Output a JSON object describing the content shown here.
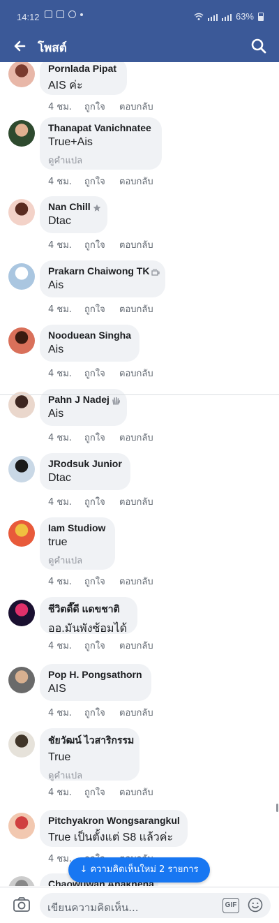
{
  "status_bar": {
    "time": "14:12",
    "battery": "63%"
  },
  "nav": {
    "title": "โพสต์"
  },
  "accent": "#3b5998",
  "comments": [
    {
      "name": "Pornlada Pipat",
      "text": "AIS ค่ะ",
      "translate": "",
      "time": "4 ชม.",
      "like": "ถูกใจ",
      "reply": "ตอบกลับ",
      "avatar_colors": [
        "#e8b7a8",
        "#7a3b2e"
      ]
    },
    {
      "name": "Thanapat Vanichnatee",
      "text": "True+Ais",
      "translate": "ดูคำแปล",
      "time": "4 ชม.",
      "like": "ถูกใจ",
      "reply": "ตอบกลับ",
      "avatar_colors": [
        "#2e4a2e",
        "#e0b090"
      ]
    },
    {
      "name": "Nan Chill",
      "badge": "star-icon",
      "text": "Dtac",
      "translate": "",
      "time": "4 ชม.",
      "like": "ถูกใจ",
      "reply": "ตอบกลับ",
      "avatar_colors": [
        "#f3d2c8",
        "#5a2b20"
      ]
    },
    {
      "name": "Prakarn Chaiwong TK",
      "badge": "coffee-icon",
      "text": "Ais",
      "translate": "",
      "time": "4 ชม.",
      "like": "ถูกใจ",
      "reply": "ตอบกลับ",
      "avatar_colors": [
        "#aac6e0",
        "#ffffff"
      ]
    },
    {
      "name": "Nooduean Singha",
      "text": "Ais",
      "translate": "",
      "time": "4 ชม.",
      "like": "ถูกใจ",
      "reply": "ตอบกลับ",
      "avatar_colors": [
        "#d9705a",
        "#3a1a10"
      ]
    },
    {
      "name": "Pahn J Nadej",
      "badge": "wave-icon",
      "text": "Ais",
      "translate": "",
      "time": "4 ชม.",
      "like": "ถูกใจ",
      "reply": "ตอบกลับ",
      "avatar_colors": [
        "#ead7cc",
        "#3d2620"
      ]
    },
    {
      "name": "JRodsuk Junior",
      "text": "Dtac",
      "translate": "",
      "time": "4 ชม.",
      "like": "ถูกใจ",
      "reply": "ตอบกลับ",
      "avatar_colors": [
        "#c9d8e6",
        "#1a1a1a"
      ]
    },
    {
      "name": "Iam Studiow",
      "text": "true",
      "translate": "ดูคำแปล",
      "time": "4 ชม.",
      "like": "ถูกใจ",
      "reply": "ตอบกลับ",
      "avatar_colors": [
        "#e85a3a",
        "#f0c040"
      ]
    },
    {
      "name": "ชีวิตดี๊ดี แดขชาติ",
      "text": "ออ.มันพังซ้อมได้",
      "translate": "",
      "time": "4 ชม.",
      "like": "ถูกใจ",
      "reply": "ตอบกลับ",
      "avatar_colors": [
        "#1a1030",
        "#e0306a"
      ]
    },
    {
      "name": "Pop H. Pongsathorn",
      "text": "AIS",
      "translate": "",
      "time": "4 ชม.",
      "like": "ถูกใจ",
      "reply": "ตอบกลับ",
      "avatar_colors": [
        "#6a6a6a",
        "#d8b090"
      ]
    },
    {
      "name": "ชัยวัฒน์ ไวสาริกรรม",
      "text": "True",
      "translate": "ดูคำแปล",
      "time": "4 ชม.",
      "like": "ถูกใจ",
      "reply": "ตอบกลับ",
      "avatar_colors": [
        "#e6e2da",
        "#403528"
      ]
    },
    {
      "name": "Pitchyakron Wongsarangkul",
      "text": "True เป็นตั้งแต่ S8 แล้วค่ะ",
      "translate": "",
      "time": "4 ชม.",
      "like": "ถูกใจ",
      "reply": "ตอบกลับ",
      "avatar_colors": [
        "#f2c8b0",
        "#d04040"
      ]
    },
    {
      "name": "Chaowuwan Anakhena",
      "text": "",
      "translate": "",
      "time": "",
      "like": "",
      "reply": "",
      "avatar_colors": [
        "#cccccc",
        "#888888"
      ]
    }
  ],
  "new_comments_pill": "↓ ความคิดเห็นใหม่ 2 รายการ",
  "composer": {
    "placeholder": "เขียนความคิดเห็น...",
    "gif_label": "GIF"
  }
}
